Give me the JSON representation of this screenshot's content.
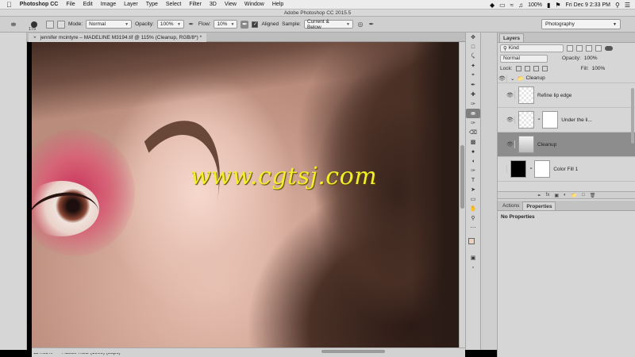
{
  "menubar": {
    "app_name": "Photoshop CC",
    "items": [
      "File",
      "Edit",
      "Image",
      "Layer",
      "Type",
      "Select",
      "Filter",
      "3D",
      "View",
      "Window",
      "Help"
    ],
    "battery": "100%",
    "datetime": "Fri Dec 9  2:33 PM"
  },
  "window": {
    "title": "Adobe Photoshop CC 2015.5"
  },
  "options": {
    "brush_size": "175",
    "mode_label": "Mode:",
    "mode_value": "Normal",
    "opacity_label": "Opacity:",
    "opacity_value": "100%",
    "flow_label": "Flow:",
    "flow_value": "10%",
    "aligned_label": "Aligned",
    "sample_label": "Sample:",
    "sample_value": "Current & Below",
    "workspace": "Photography"
  },
  "document": {
    "tab_title": "jennifer mcintyre – MADELINE M3194.tif @ 115% (Cleanup, RGB/8*) *",
    "zoom": "114.65%",
    "profile": "Adobe RGB (1998) (8bpc)"
  },
  "watermark": "www.cgtsj.com",
  "layers_panel": {
    "tab": "Layers",
    "filter_value": "Kind",
    "blend_mode": "Normal",
    "opacity_label": "Opacity:",
    "opacity_value": "100%",
    "lock_label": "Lock:",
    "fill_label": "Fill:",
    "fill_value": "100%",
    "layers": [
      {
        "name": "Cleanup",
        "type": "group"
      },
      {
        "name": "Refine lip edge",
        "type": "layer"
      },
      {
        "name": "Under the li...",
        "type": "layer"
      },
      {
        "name": "Cleanup",
        "type": "layer",
        "selected": true
      },
      {
        "name": "Color Fill 1",
        "type": "fill"
      }
    ]
  },
  "properties_panel": {
    "tabs": [
      "Actions",
      "Properties"
    ],
    "message": "No Properties"
  },
  "colors": {
    "foreground": "#e8cfc4",
    "background": "#ffffff",
    "watermark": "#f2ef2a"
  }
}
